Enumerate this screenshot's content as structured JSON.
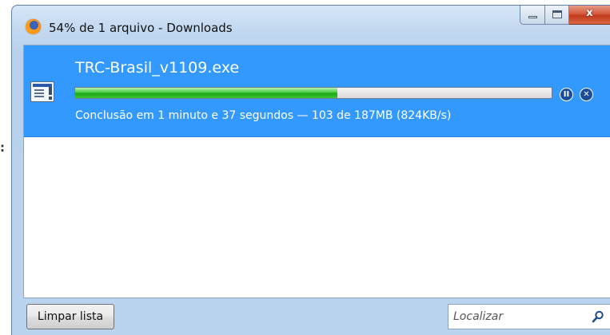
{
  "window": {
    "title": "54% de 1 arquivo - Downloads",
    "icon": "firefox-icon",
    "controls": {
      "minimize_icon": "minimize-icon",
      "maximize_icon": "maximize-icon",
      "close_symbol": "x"
    }
  },
  "left_fragment": ":",
  "download": {
    "file_name": "TRC-Brasil_v1109.exe",
    "file_icon": "exe-file-icon",
    "progress_fraction": 0.55,
    "status": "Conclusão em 1 minuto e 37 segundos — 103 de 187MB (824KB/s)",
    "pause_symbol": "II",
    "cancel_symbol": "✕",
    "selected": true
  },
  "bottom": {
    "clear_button_label": "Limpar lista",
    "search_placeholder": "Localizar",
    "search_icon": "search-icon"
  },
  "colors": {
    "selection": "#3399ff",
    "progress_green": "#2fb82a",
    "chrome_blue": "#c3d9f1"
  }
}
